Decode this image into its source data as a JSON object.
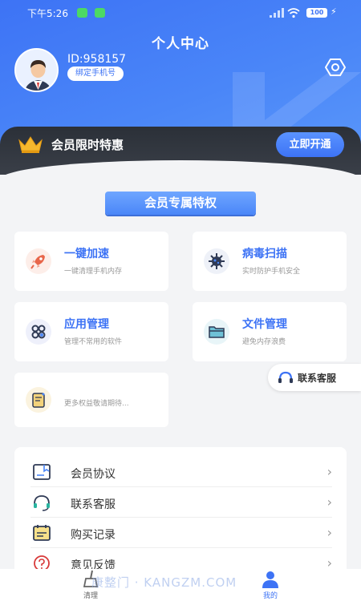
{
  "status_bar": {
    "time": "下午5:26",
    "battery": "100"
  },
  "header": {
    "title": "个人中心",
    "user_id": "ID:958157",
    "bind_phone_label": "绑定手机号"
  },
  "vip_banner": {
    "title": "会员限时特惠",
    "button_label": "立即开通"
  },
  "privileges": {
    "title": "会员专属特权",
    "cards": [
      {
        "title": "一键加速",
        "subtitle": "一键清理手机内存",
        "icon": "rocket-icon"
      },
      {
        "title": "病毒扫描",
        "subtitle": "实时防护手机安全",
        "icon": "virus-icon"
      },
      {
        "title": "应用管理",
        "subtitle": "管理不常用的软件",
        "icon": "apps-icon"
      },
      {
        "title": "文件管理",
        "subtitle": "避免内存浪费",
        "icon": "folder-icon"
      }
    ],
    "more_text": "更多权益敬请期待..."
  },
  "contact_float_label": "联系客服",
  "menu": [
    {
      "label": "会员协议",
      "icon": "agreement-icon"
    },
    {
      "label": "联系客服",
      "icon": "headset-icon"
    },
    {
      "label": "购买记录",
      "icon": "record-icon"
    },
    {
      "label": "意见反馈",
      "icon": "feedback-icon"
    }
  ],
  "bottom_nav": {
    "tabs": [
      {
        "label": "清理"
      },
      {
        "label": "我的"
      }
    ]
  },
  "watermark": "康整门 · KANGZM.COM",
  "colors": {
    "primary": "#3d73f5",
    "vip_dark": "#2b3038",
    "gold": "#f5b82e"
  }
}
